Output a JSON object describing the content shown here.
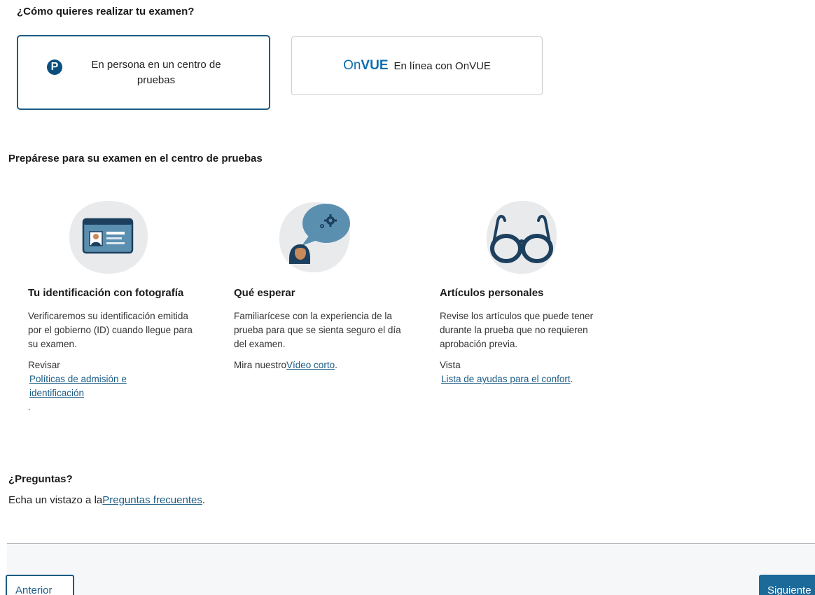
{
  "question": {
    "title": "¿Cómo quieres realizar tu examen?"
  },
  "options": {
    "in_person": {
      "label": "En persona en un centro de pruebas",
      "selected": true
    },
    "online": {
      "logo_on": "On",
      "logo_vue": "VUE",
      "label": "En línea con OnVUE",
      "selected": false
    }
  },
  "prep": {
    "title": "Prepárese para su examen en el centro de pruebas",
    "cards": [
      {
        "icon": "id-card-icon",
        "title": "Tu identificación con fotografía",
        "text": "Verificaremos su identificación emitida por el gobierno (ID) cuando llegue para su examen.",
        "pre_link": "Revisar",
        "link": "Políticas de admisión e identificación",
        "post_link": "."
      },
      {
        "icon": "person-speech-gear-icon",
        "title": "Qué esperar",
        "text": "Familiarícese con la experiencia de la prueba para que se sienta seguro el día del examen.",
        "pre_link": "Mira nuestro",
        "link": "Vídeo corto",
        "post_link": "."
      },
      {
        "icon": "glasses-icon",
        "title": "Artículos personales",
        "text": "Revise los artículos que puede tener durante la prueba que no requieren aprobación previa.",
        "pre_link": "Vista",
        "link": "Lista de ayudas para el confort",
        "post_link": "."
      }
    ]
  },
  "faq": {
    "title": "¿Preguntas?",
    "pre_link": "Echa un vistazo a la",
    "link": "Preguntas frecuentes",
    "post_link": "."
  },
  "footer": {
    "prev_label": "Anterior",
    "next_label": "Siguiente"
  },
  "colors": {
    "primary": "#1b5c84",
    "next_button": "#1b6a9a",
    "blob": "#e8eaec",
    "icon_dark": "#1d3f5e"
  }
}
